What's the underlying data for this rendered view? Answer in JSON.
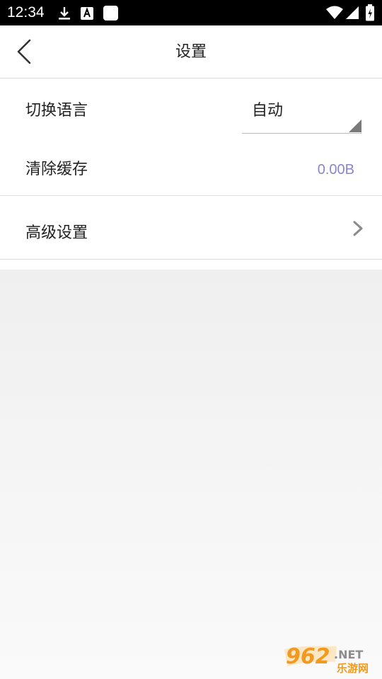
{
  "status_bar": {
    "time": "12:34",
    "icons": [
      "download-icon",
      "a-notification-icon",
      "blank-notification-icon",
      "wifi-icon",
      "signal-icon",
      "battery-icon"
    ]
  },
  "app_bar": {
    "title": "设置",
    "back_icon": "chevron-left-icon"
  },
  "settings": {
    "language": {
      "label": "切换语言",
      "value": "自动"
    },
    "cache": {
      "label": "清除缓存",
      "size": "0.00B"
    },
    "advanced": {
      "label": "高级设置"
    }
  },
  "watermark": {
    "brand_number": "962",
    "brand_suffix": ".NET",
    "brand_cn": "乐游网"
  },
  "colors": {
    "accent_text": "#8a86c8",
    "divider": "#dddddd",
    "background_gray": "#f2f2f2",
    "watermark_orange": "#f29a1f"
  }
}
